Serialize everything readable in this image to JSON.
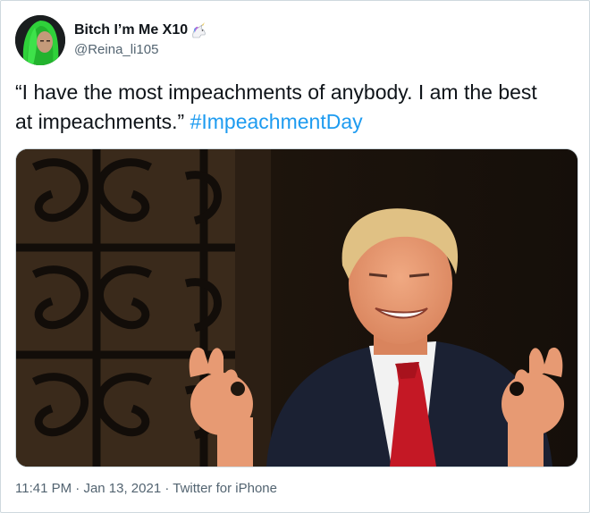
{
  "user": {
    "display_name": "Bitch I’m Me X10",
    "handle": "@Reina_li105",
    "name_emoji": "unicorn-icon"
  },
  "tweet": {
    "text": "“I have the most impeachments of anybody. I am the best at impeachments.” ",
    "hashtag": "#ImpeachmentDay"
  },
  "footer": {
    "time": "11:41 PM",
    "separator": " · ",
    "date": "Jan 13, 2021",
    "source": "Twitter for iPhone"
  },
  "colors": {
    "text": "#0f1419",
    "secondary": "#536471",
    "link": "#1d9bf0",
    "border": "#cfd9de"
  }
}
